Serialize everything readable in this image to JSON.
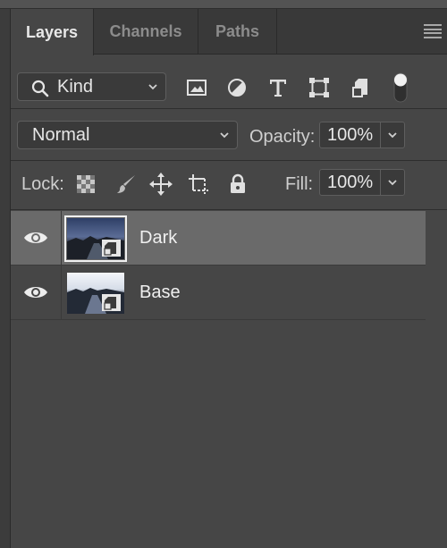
{
  "tabs": [
    {
      "label": "Layers",
      "active": true
    },
    {
      "label": "Channels",
      "active": false
    },
    {
      "label": "Paths",
      "active": false
    }
  ],
  "filter": {
    "kind_label": "Kind",
    "icons": [
      "image-filter-icon",
      "adjustment-filter-icon",
      "type-filter-icon",
      "shape-filter-icon",
      "smart-object-filter-icon",
      "filter-toggle-icon"
    ]
  },
  "blend": {
    "mode": "Normal",
    "opacity_label": "Opacity:",
    "opacity_value": "100%"
  },
  "lock": {
    "label": "Lock:",
    "icons": [
      "lock-transparent-pixels-icon",
      "lock-image-pixels-icon",
      "lock-position-icon",
      "lock-artboard-icon",
      "lock-all-icon"
    ],
    "fill_label": "Fill:",
    "fill_value": "100%"
  },
  "layers": [
    {
      "name": "Dark",
      "selected": true,
      "visible": true
    },
    {
      "name": "Base",
      "selected": false,
      "visible": true
    }
  ],
  "colors": {
    "panel_bg": "#464646",
    "selected_row": "#6a6a6a",
    "tab_bar": "#393939"
  }
}
